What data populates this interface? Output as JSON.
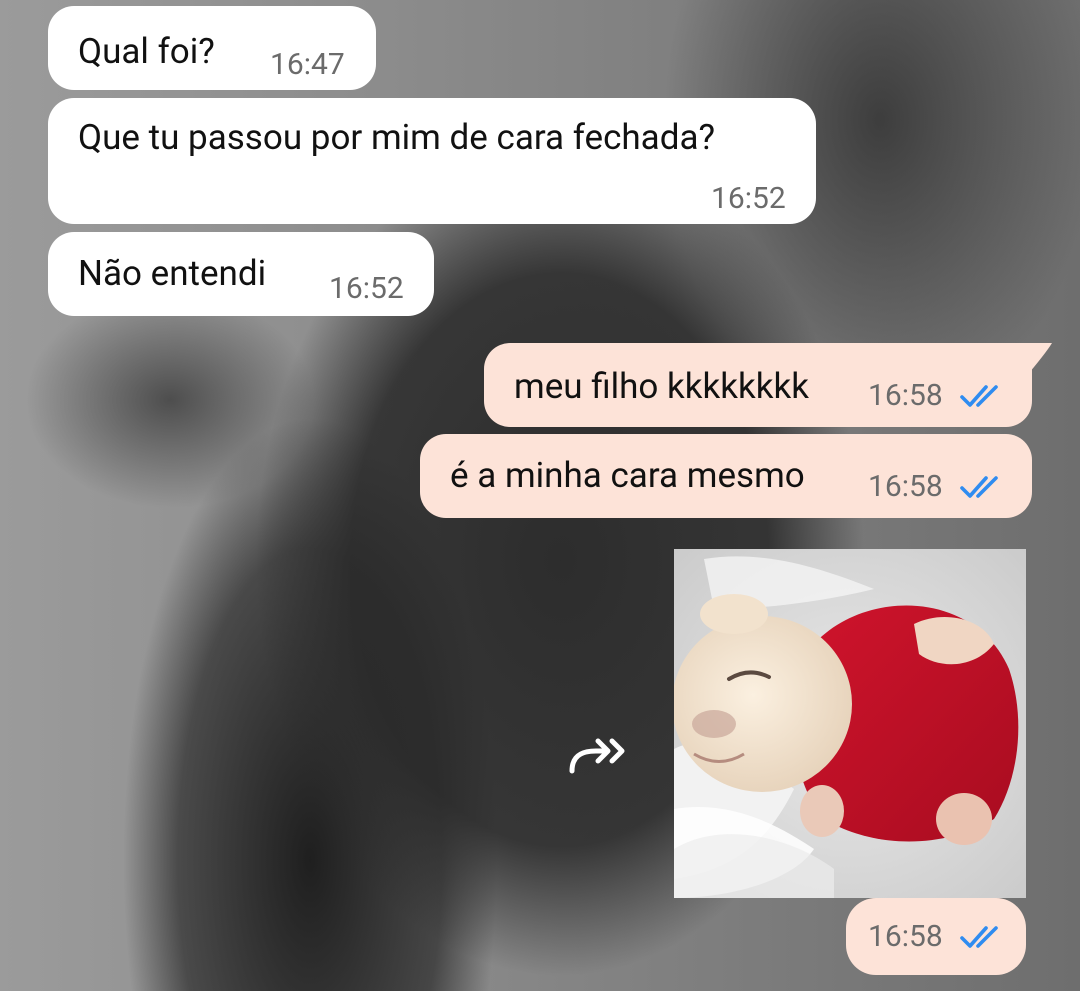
{
  "chat": {
    "messages": [
      {
        "direction": "incoming",
        "text": "Qual foi?",
        "time": "16:47"
      },
      {
        "direction": "incoming",
        "text": "Que tu passou por mim de cara fechada?",
        "time": "16:52"
      },
      {
        "direction": "incoming",
        "text": "Não entendi",
        "time": "16:52"
      },
      {
        "direction": "outgoing",
        "text": "meu filho kkkkkkkk",
        "time": "16:58",
        "status": "read"
      },
      {
        "direction": "outgoing",
        "text": "é a minha cara mesmo",
        "time": "16:58",
        "status": "read"
      },
      {
        "direction": "outgoing",
        "type": "sticker",
        "time": "16:58",
        "status": "read"
      }
    ]
  },
  "icons": {
    "read_receipt": "double-check-icon",
    "forward": "forward-icon"
  },
  "colors": {
    "incoming_bubble": "#ffffff",
    "outgoing_bubble": "#fde3d8",
    "read_tick": "#2f8cf0",
    "timestamp": "#6b6b6b"
  }
}
